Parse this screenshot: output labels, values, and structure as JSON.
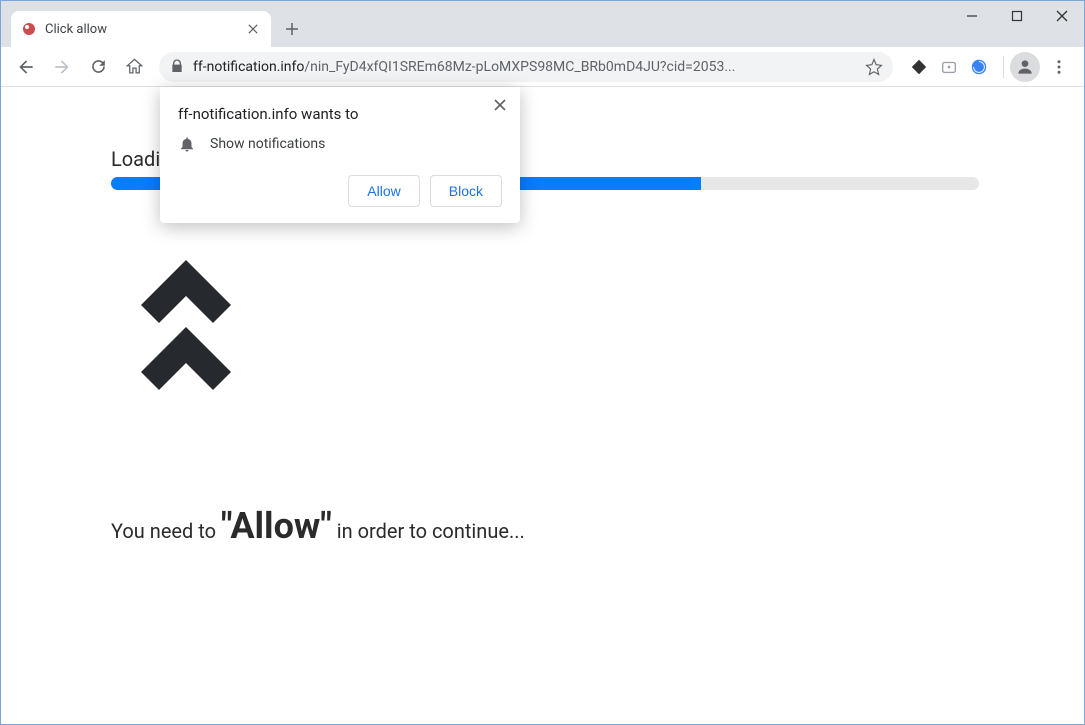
{
  "window": {
    "tab_title": "Click allow"
  },
  "address": {
    "domain": "ff-notification.info",
    "path": "/nin_FyD4xfQI1SREm68Mz-pLoMXPS98MC_BRb0mD4JU?cid=2053..."
  },
  "notification": {
    "title": "ff-notification.info wants to",
    "permission_text": "Show notifications",
    "allow_label": "Allow",
    "block_label": "Block"
  },
  "page": {
    "loading_prefix": "Loadin",
    "progress_pct": 68,
    "msg_part1": "You need to ",
    "msg_emphasis": "\"Allow\"",
    "msg_part2": " in order to continue..."
  }
}
